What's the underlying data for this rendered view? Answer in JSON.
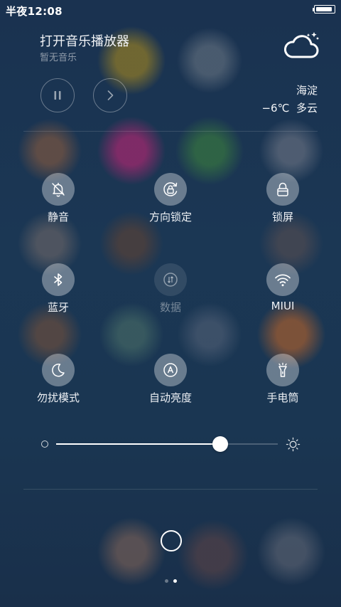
{
  "status_bar": {
    "time": "半夜12:08",
    "battery_level": 1.0
  },
  "music": {
    "title": "打开音乐播放器",
    "subtitle": "暂无音乐",
    "pause_icon": "pause-icon",
    "next_icon": "chevron-right-icon"
  },
  "weather": {
    "icon": "cloud-night-icon",
    "location": "海淀",
    "temperature": "−6℃",
    "condition": "多云"
  },
  "toggles": [
    {
      "label": "静音",
      "icon": "bell-off-icon",
      "active": true
    },
    {
      "label": "方向锁定",
      "icon": "rotation-lock-icon",
      "active": true
    },
    {
      "label": "锁屏",
      "icon": "lock-icon",
      "active": true
    },
    {
      "label": "蓝牙",
      "icon": "bluetooth-icon",
      "active": true
    },
    {
      "label": "数据",
      "icon": "mobile-data-icon",
      "active": false
    },
    {
      "label": "MIUI",
      "icon": "wifi-icon",
      "active": true
    },
    {
      "label": "勿扰模式",
      "icon": "moon-icon",
      "active": true
    },
    {
      "label": "自动亮度",
      "icon": "auto-brightness-icon",
      "active": true
    },
    {
      "label": "手电筒",
      "icon": "flashlight-icon",
      "active": true
    }
  ],
  "brightness": {
    "level": 0.74,
    "min_icon": "brightness-low-icon",
    "max_icon": "sun-icon"
  },
  "pager": {
    "page_count": 2,
    "current_page": 2
  },
  "colors": {
    "background": "#1b3754",
    "accent": "#ffffff"
  }
}
